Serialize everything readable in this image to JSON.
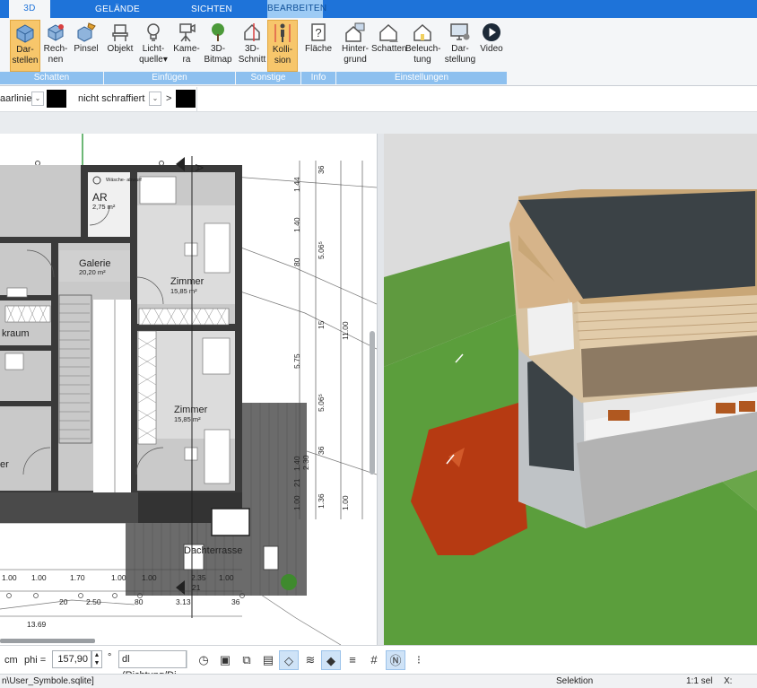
{
  "tabs": [
    {
      "label": "3D",
      "state": "active"
    },
    {
      "label": "GELÄNDE",
      "state": "normal"
    },
    {
      "label": "SICHTEN",
      "state": "normal"
    },
    {
      "label": "BEARBEITEN",
      "state": "context"
    }
  ],
  "ribbon": {
    "buttons": [
      {
        "id": "darstellen",
        "label": "Dar-\nstellen",
        "icon": "cube-icon",
        "active": true
      },
      {
        "id": "rechnen",
        "label": "Rech-\nnen",
        "icon": "cube-calc-icon",
        "active": false
      },
      {
        "id": "pinsel",
        "label": "Pinsel",
        "icon": "brush-cube-icon",
        "active": false
      },
      {
        "id": "objekt",
        "label": "Objekt",
        "icon": "chair-icon",
        "active": false
      },
      {
        "id": "lichtquelle",
        "label": "Licht-\nquelle▾",
        "icon": "bulb-icon",
        "active": false
      },
      {
        "id": "kamera",
        "label": "Kame-\nra",
        "icon": "camera-icon",
        "active": false
      },
      {
        "id": "bitmap",
        "label": "3D-\nBitmap",
        "icon": "tree-icon",
        "active": false
      },
      {
        "id": "schnitt",
        "label": "3D-\nSchnitt",
        "icon": "section-icon",
        "active": false
      },
      {
        "id": "kollision",
        "label": "Kolli-\nsion",
        "icon": "person-icon",
        "active": true
      },
      {
        "id": "flaeche",
        "label": "Fläche",
        "icon": "area-question-icon",
        "active": false
      },
      {
        "id": "hintergrund",
        "label": "Hinter-\ngrund",
        "icon": "house-bg-icon",
        "active": false
      },
      {
        "id": "schatten2",
        "label": "Schatten",
        "icon": "house-shadow-icon",
        "active": false
      },
      {
        "id": "beleuchtung",
        "label": "Beleuch-\ntung",
        "icon": "house-light-icon",
        "active": false
      },
      {
        "id": "darstellung",
        "label": "Dar-\nstellung",
        "icon": "monitor-gear-icon",
        "active": false
      },
      {
        "id": "video",
        "label": "Video",
        "icon": "play-circle-icon",
        "active": false
      }
    ],
    "groups": [
      "Schatten",
      "Einfügen",
      "Sonstige",
      "Info",
      "Einstellungen"
    ]
  },
  "propbar": {
    "line_label": "aarlinie",
    "hatch_label": "nicht schraffiert",
    "arrow": ">"
  },
  "plan": {
    "rooms": [
      {
        "name": "AR",
        "area": "2,75 m²"
      },
      {
        "name": "Galerie",
        "area": "20,20 m²"
      },
      {
        "name": "Zimmer",
        "area": "15,85 m²"
      },
      {
        "name": "Zimmer",
        "area": "15,85 m²"
      },
      {
        "name": "kraum",
        "area": ""
      },
      {
        "name": "Dachterrasse",
        "area": ""
      }
    ],
    "washer_label": "Wäsche-\nabwurf",
    "section_marker": "A",
    "dims_vertical_right": [
      "36",
      "1.44",
      "1.40",
      "80",
      "5.06⁵",
      "15",
      "5.75",
      "11.00",
      "5.06⁵",
      "36",
      "1.40",
      "21",
      "2.30",
      "1.00",
      "1.36",
      "1.00"
    ],
    "dims_bottom_row1": [
      "1.00",
      "1.00",
      "1.70",
      "1.00",
      "1.00",
      "2.35",
      "1.00"
    ],
    "dims_bottom_row2": [
      "20",
      "2.50",
      "80",
      "3.13",
      "36"
    ],
    "dims_bottom_total": "13.69",
    "dims_bottom_extra": "21"
  },
  "bottombar": {
    "unit": "cm",
    "phi_label": "phi =",
    "phi_value": "157,90",
    "degree": "°",
    "direction_label": "dl (Richtung/Di"
  },
  "statusbar": {
    "file": "n\\User_Symbole.sqlite]",
    "mode": "Selektion",
    "scale": "1:1 sel",
    "x_label": "X:"
  },
  "colors": {
    "tab_bar": "#1e73d9",
    "active_button": "#f7c66b",
    "group_label": "#8dc0ef",
    "grass": "#5b9e3c",
    "red_terrain": "#b63a12",
    "roof": "#3b4246",
    "wood": "#d6b48a"
  }
}
